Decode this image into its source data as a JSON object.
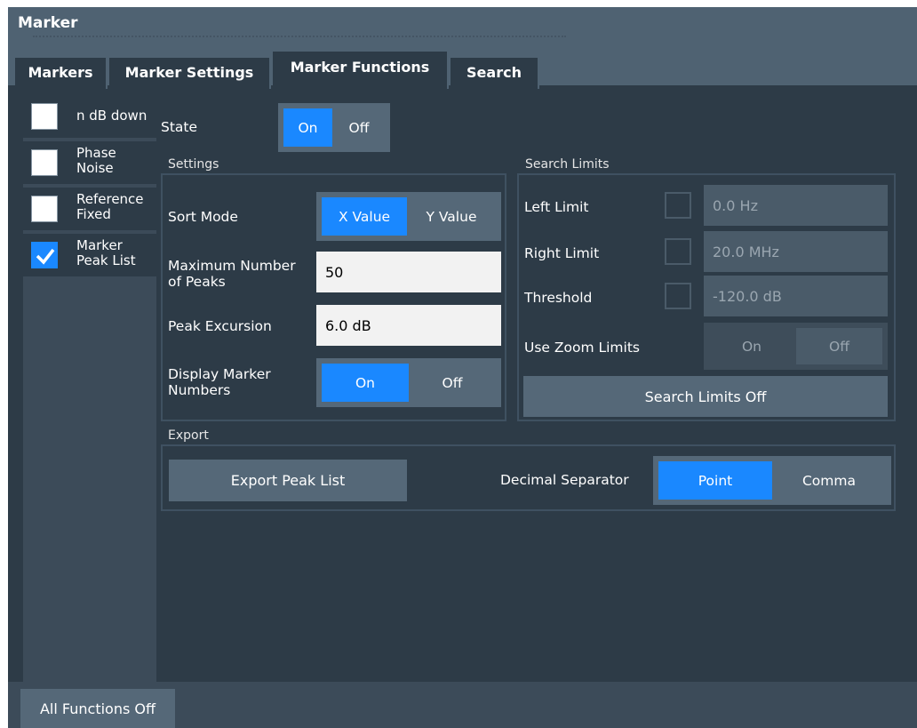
{
  "window": {
    "title": "Marker"
  },
  "tabs": [
    {
      "label": "Markers"
    },
    {
      "label": "Marker Settings"
    },
    {
      "label": "Marker Functions"
    },
    {
      "label": "Search"
    }
  ],
  "sidebar": {
    "items": [
      {
        "label": "n dB down",
        "checked": false
      },
      {
        "label": "Phase\nNoise",
        "checked": false
      },
      {
        "label": "Reference\nFixed",
        "checked": false
      },
      {
        "label": "Marker\nPeak List",
        "checked": true
      }
    ]
  },
  "state": {
    "label": "State",
    "on": "On",
    "off": "Off",
    "selected": "On"
  },
  "settings": {
    "title": "Settings",
    "sort_mode": {
      "label": "Sort Mode",
      "opt1": "X Value",
      "opt2": "Y Value",
      "selected": "X Value"
    },
    "max_peaks": {
      "label": "Maximum Number\nof Peaks",
      "value": "50"
    },
    "peak_excursion": {
      "label": "Peak Excursion",
      "value": "6.0 dB"
    },
    "display_numbers": {
      "label": "Display Marker\nNumbers",
      "on": "On",
      "off": "Off",
      "selected": "On"
    }
  },
  "search_limits": {
    "title": "Search Limits",
    "left": {
      "label": "Left Limit",
      "value": "0.0 Hz"
    },
    "right": {
      "label": "Right Limit",
      "value": "20.0 MHz"
    },
    "threshold": {
      "label": "Threshold",
      "value": "-120.0 dB"
    },
    "zoom": {
      "label": "Use Zoom Limits",
      "on": "On",
      "off": "Off"
    },
    "off_button": "Search Limits Off"
  },
  "export": {
    "title": "Export",
    "button": "Export Peak List",
    "decimal_label": "Decimal Separator",
    "point": "Point",
    "comma": "Comma",
    "selected": "Point"
  },
  "bottom": {
    "all_off": "All Functions Off"
  },
  "colors": {
    "accent": "#1a88ff",
    "background": "#2d3b47",
    "titlebar": "#4f6272"
  }
}
